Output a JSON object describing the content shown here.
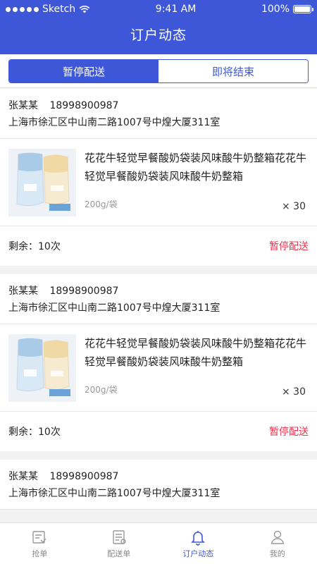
{
  "status_bar": {
    "carrier": "Sketch",
    "time": "9:41 AM",
    "battery": "100%"
  },
  "header": {
    "title": "订户动态"
  },
  "segments": [
    {
      "label": "暂停配送",
      "active": true
    },
    {
      "label": "即将结束",
      "active": false
    }
  ],
  "orders": [
    {
      "name": "张某某",
      "phone": "18998900987",
      "address": "上海市徐汇区中山南二路1007号中煌大厦311室",
      "product": {
        "name": "花花牛轻觉早餐酸奶袋装风味酸牛奶整箱花花牛轻觉早餐酸奶袋装风味酸牛奶整箱",
        "spec": "200g/袋",
        "qty": "× 30"
      },
      "remaining": "剩余：10次",
      "action": "暂停配送"
    },
    {
      "name": "张某某",
      "phone": "18998900987",
      "address": "上海市徐汇区中山南二路1007号中煌大厦311室",
      "product": {
        "name": "花花牛轻觉早餐酸奶袋装风味酸牛奶整箱花花牛轻觉早餐酸奶袋装风味酸牛奶整箱",
        "spec": "200g/袋",
        "qty": "× 30"
      },
      "remaining": "剩余：10次",
      "action": "暂停配送"
    },
    {
      "name": "张某某",
      "phone": "18998900987",
      "address": "上海市徐汇区中山南二路1007号中煌大厦311室"
    }
  ],
  "tabbar": [
    {
      "label": "抢单",
      "icon": "grab-order-icon",
      "active": false
    },
    {
      "label": "配送单",
      "icon": "delivery-list-icon",
      "active": false
    },
    {
      "label": "订户动态",
      "icon": "bell-icon",
      "active": true
    },
    {
      "label": "我的",
      "icon": "person-icon",
      "active": false
    }
  ],
  "colors": {
    "brand": "#3e57d8",
    "danger": "#e8324e"
  }
}
